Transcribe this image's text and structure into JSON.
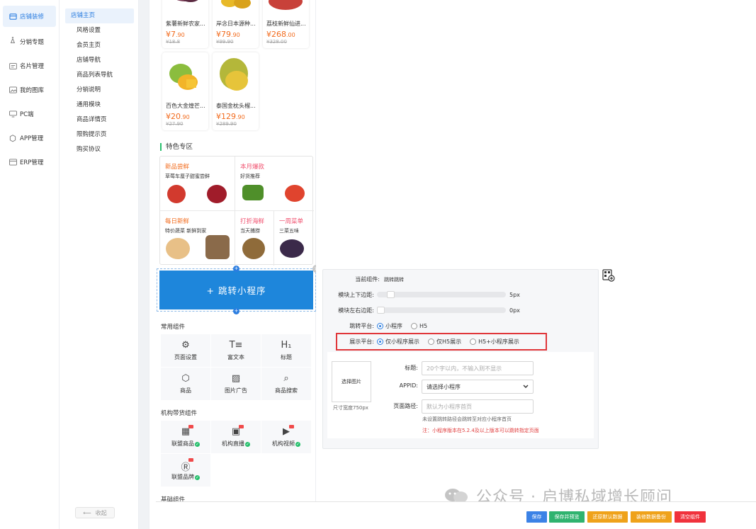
{
  "nav_primary": [
    {
      "label": "店铺装修",
      "icon": "shop-icon",
      "active": true
    },
    {
      "label": "分销专题",
      "icon": "distribution-icon"
    },
    {
      "label": "名片管理",
      "icon": "card-icon"
    },
    {
      "label": "我的图库",
      "icon": "gallery-icon"
    },
    {
      "label": "PC端",
      "icon": "monitor-icon"
    },
    {
      "label": "APP管理",
      "icon": "app-icon"
    },
    {
      "label": "ERP管理",
      "icon": "erp-icon"
    }
  ],
  "nav_secondary": [
    "店铺主页",
    "风格设置",
    "会员主页",
    "店铺导航",
    "商品列表导航",
    "分销说明",
    "通用模块",
    "商品详情页",
    "限购提示页",
    "购买协议"
  ],
  "collapse_label": "收起",
  "products_row1": [
    {
      "name": "紫薯新鲜农家...",
      "price_int": "7",
      "price_dec": ".90",
      "old": "¥18.8"
    },
    {
      "name": "岸念日本源种...",
      "price_int": "79",
      "price_dec": ".90",
      "old": "¥99.90"
    },
    {
      "name": "荔枝新鲜仙进...",
      "price_int": "268",
      "price_dec": ".00",
      "old": "¥328.00"
    }
  ],
  "products_row2": [
    {
      "name": "百色大金煌芒...",
      "price_int": "20",
      "price_dec": ".90",
      "old": "¥27.90"
    },
    {
      "name": "泰国金枕头榴...",
      "price_int": "129",
      "price_dec": ".90",
      "old": "¥289.90"
    }
  ],
  "feature": {
    "title": "特色专区",
    "cells": [
      {
        "title": "新品尝鲜",
        "sub": "草莓车厘子甜蜜尝鲜",
        "color": "#f26b1d"
      },
      {
        "title": "本月爆款",
        "sub": "好货推荐",
        "color": "#f0506e"
      },
      {
        "title": "每日新鲜",
        "sub": "特价蔬菜 新鲜到家",
        "color": "#f26b1d"
      },
      {
        "title": "打折海鲜",
        "sub": "当天捕捞",
        "color": "#f0506e"
      },
      {
        "title": "一周菜单",
        "sub": "三菜五味",
        "color": "#f0506e"
      }
    ]
  },
  "jump_button": "+ 跳转小程序",
  "common_components": {
    "title": "常用组件",
    "items": [
      {
        "label": "页面设置",
        "glyph": "⚙"
      },
      {
        "label": "富文本",
        "glyph": "T≡"
      },
      {
        "label": "标题",
        "glyph": "H₁"
      },
      {
        "label": "商品",
        "glyph": "⬡"
      },
      {
        "label": "图片广告",
        "glyph": "▨"
      },
      {
        "label": "商品搜索",
        "glyph": "⌕"
      }
    ]
  },
  "org_components": {
    "title": "机构带货组件",
    "items": [
      {
        "label": "联盟商品",
        "glyph": "▦"
      },
      {
        "label": "机构直播",
        "glyph": "▣"
      },
      {
        "label": "机构视频",
        "glyph": "▶"
      },
      {
        "label": "联盟品牌",
        "glyph": "Ⓡ"
      }
    ]
  },
  "basic_components_title": "基础组件",
  "props": {
    "current_label": "当前组件:",
    "current_value": "跳转跳转",
    "margin_tb_label": "模块上下边距:",
    "margin_tb_value": "5px",
    "margin_tb_level": 0.08,
    "margin_lr_label": "模块左右边距:",
    "margin_lr_value": "0px",
    "margin_lr_level": 0.0,
    "platform_label": "跳转平台:",
    "platform_options": [
      "小程序",
      "H5"
    ],
    "platform_selected": 0,
    "display_label": "展示平台:",
    "display_options": [
      "仅小程序展示",
      "仅H5展示",
      "H5+小程序展示"
    ],
    "display_selected": 0,
    "select_image": "选择图片",
    "size_hint": "尺寸宽度750px",
    "title_label": "标题:",
    "title_placeholder": "20个字以内，不输入则不显示",
    "appid_label": "APPID:",
    "appid_value": "请选择小程序",
    "path_label": "页面路径:",
    "path_placeholder": "默认为小程序首页",
    "note": "未设置跳转路径会跳转至对应小程序首页",
    "warning": "注：小程序版本在5.2.4及以上版本可以跳转指定页面"
  },
  "bottom_buttons": [
    {
      "label": "保存",
      "color": "#3b82e6"
    },
    {
      "label": "保存并预览",
      "color": "#2fb36f"
    },
    {
      "label": "还原默认数据",
      "color": "#efa21a"
    },
    {
      "label": "装修数据备份",
      "color": "#efa21a"
    },
    {
      "label": "清空组件",
      "color": "#f0323c"
    }
  ],
  "watermark": "公众号 · 启博私域增长顾问"
}
